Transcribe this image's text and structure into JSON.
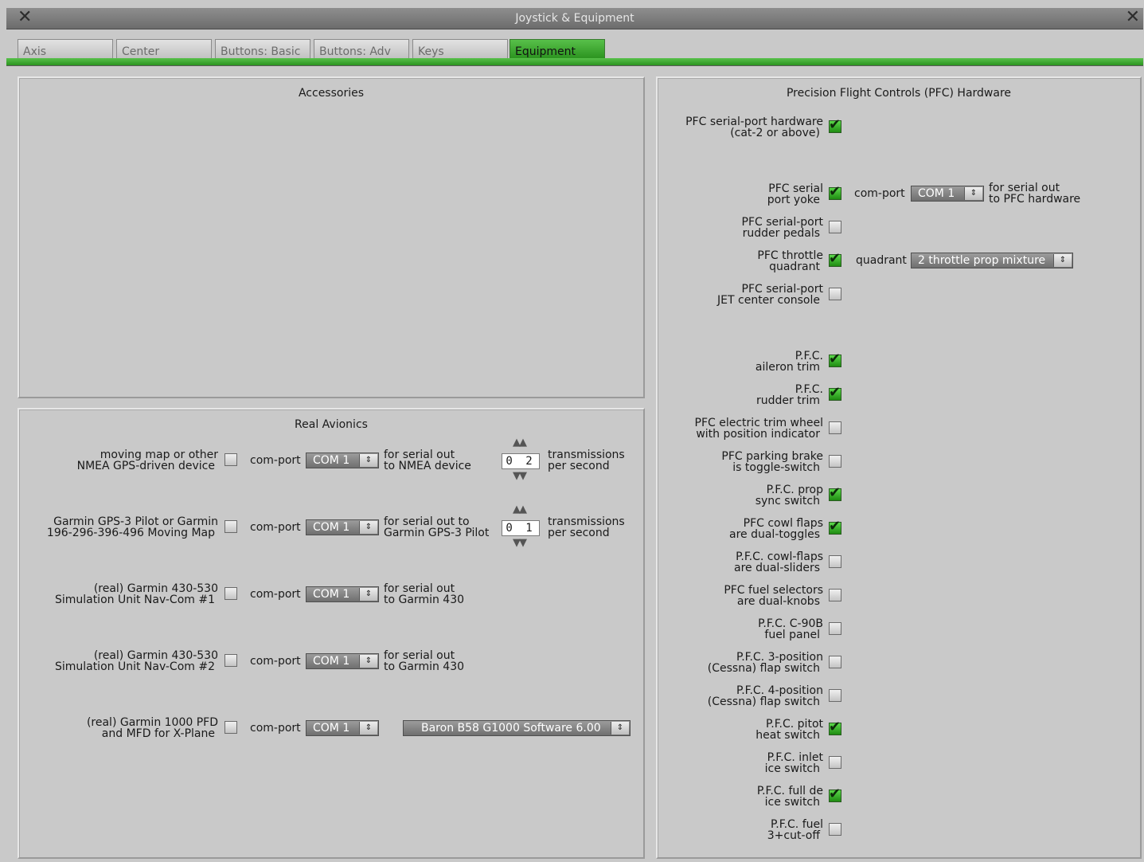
{
  "window": {
    "title": "Joystick & Equipment",
    "close_left": "✕",
    "close_right": "✕"
  },
  "tabs": [
    "Axis",
    "Center",
    "Buttons: Basic",
    "Buttons: Adv",
    "Keys",
    "Equipment"
  ],
  "active_tab": "Equipment",
  "accessories": {
    "title": "Accessories"
  },
  "avionics": {
    "title": "Real Avionics",
    "rows": [
      {
        "label1": "moving map or other",
        "label2": "NMEA GPS-driven device",
        "checked": false,
        "port_label": "com-port",
        "port": "COM 1",
        "desc1": "for serial out",
        "desc2": "to NMEA device",
        "rate": "0 2",
        "rate1": "transmissions",
        "rate2": "per second"
      },
      {
        "label1": "Garmin GPS-3 Pilot or Garmin",
        "label2": "196-296-396-496 Moving Map",
        "checked": false,
        "port_label": "com-port",
        "port": "COM 1",
        "desc1": "for serial out to",
        "desc2": "Garmin GPS-3 Pilot",
        "rate": "0 1",
        "rate1": "transmissions",
        "rate2": "per second"
      },
      {
        "label1": "(real) Garmin 430-530",
        "label2": "Simulation Unit Nav-Com #1",
        "checked": false,
        "port_label": "com-port",
        "port": "COM 1",
        "desc1": "for serial out",
        "desc2": "to Garmin 430"
      },
      {
        "label1": "(real) Garmin 430-530",
        "label2": "Simulation Unit Nav-Com #2",
        "checked": false,
        "port_label": "com-port",
        "port": "COM 1",
        "desc1": "for serial out",
        "desc2": "to Garmin 430"
      },
      {
        "label1": "(real) Garmin 1000 PFD",
        "label2": "and MFD for X-Plane",
        "checked": false,
        "port_label": "com-port",
        "port": "COM 1",
        "software": "Baron B58 G1000 Software 6.00"
      }
    ]
  },
  "pfc": {
    "title": "Precision Flight Controls (PFC) Hardware",
    "items": [
      {
        "l1": "PFC serial-port hardware",
        "l2": "(cat-2 or above)",
        "checked": true
      },
      {
        "l1": "PFC serial",
        "l2": "port yoke",
        "checked": true
      },
      {
        "l1": "PFC serial-port",
        "l2": "rudder pedals",
        "checked": false
      },
      {
        "l1": "PFC throttle",
        "l2": "quadrant",
        "checked": true
      },
      {
        "l1": "PFC serial-port",
        "l2": "JET center console",
        "checked": false
      },
      {
        "l1": "P.F.C.",
        "l2": "aileron trim",
        "checked": true
      },
      {
        "l1": "P.F.C.",
        "l2": "rudder trim",
        "checked": true
      },
      {
        "l1": "PFC electric trim wheel",
        "l2": "with position indicator",
        "checked": false
      },
      {
        "l1": "PFC parking brake",
        "l2": "is toggle-switch",
        "checked": false
      },
      {
        "l1": "P.F.C. prop",
        "l2": "sync switch",
        "checked": true
      },
      {
        "l1": "PFC cowl flaps",
        "l2": "are dual-toggles",
        "checked": true
      },
      {
        "l1": "P.F.C. cowl-flaps",
        "l2": "are dual-sliders",
        "checked": false
      },
      {
        "l1": "PFC fuel selectors",
        "l2": "are dual-knobs",
        "checked": false
      },
      {
        "l1": "P.F.C. C-90B",
        "l2": "fuel panel",
        "checked": false
      },
      {
        "l1": "P.F.C. 3-position",
        "l2": "(Cessna) flap switch",
        "checked": false
      },
      {
        "l1": "P.F.C. 4-position",
        "l2": "(Cessna) flap switch",
        "checked": false
      },
      {
        "l1": "P.F.C. pitot",
        "l2": "heat switch",
        "checked": true
      },
      {
        "l1": "P.F.C. inlet",
        "l2": "ice switch",
        "checked": false
      },
      {
        "l1": "P.F.C. full de",
        "l2": "ice switch",
        "checked": true
      },
      {
        "l1": "P.F.C. fuel",
        "l2": "3+cut-off",
        "checked": false
      }
    ],
    "yoke_port": {
      "label": "com-port",
      "value": "COM 1",
      "desc1": "for serial out",
      "desc2": "to PFC hardware"
    },
    "quadrant": {
      "label": "quadrant",
      "value": "2 throttle prop mixture"
    }
  },
  "icons": {
    "check": "✔",
    "select_arrow": "⇕",
    "spin_up": "▲▲",
    "spin_down": "▼▼"
  },
  "colors": {
    "accent_green": "#2c9420",
    "window_bg": "#c9c9c9"
  }
}
